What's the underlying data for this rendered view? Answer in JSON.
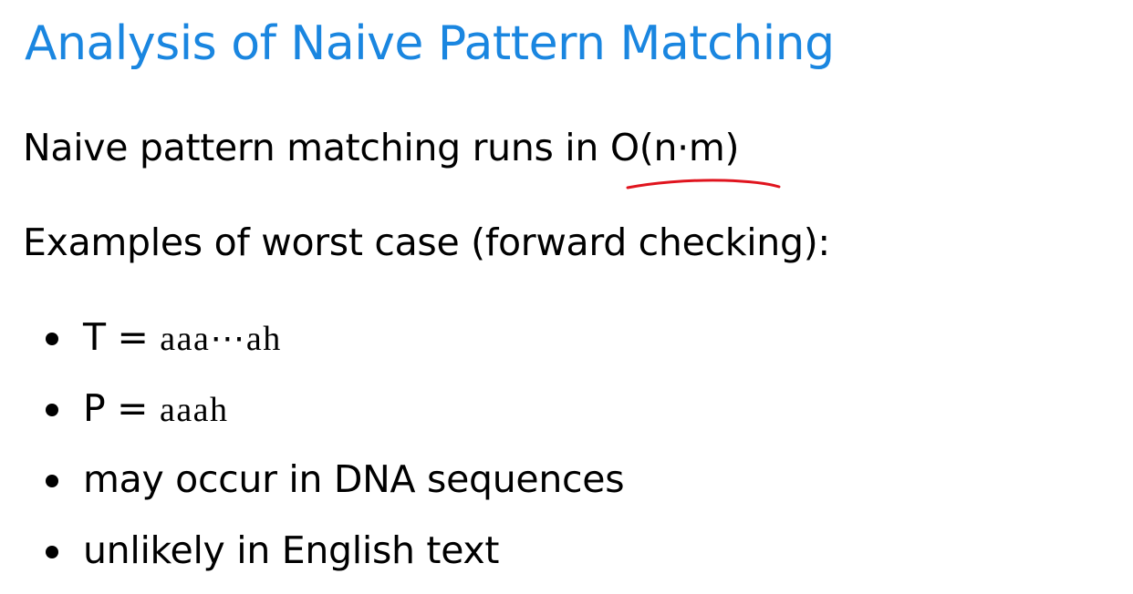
{
  "slide": {
    "title": "Analysis of Naive Pattern Matching",
    "line1_text": "Naive pattern matching runs in ",
    "line1_complexity": "O(n·m)",
    "line2_text": "Examples of worst case (forward checking):",
    "bullets": [
      {
        "prefix": "T = ",
        "value": "aaa⋯ah"
      },
      {
        "prefix": "P = ",
        "value": "aaah"
      },
      {
        "text": "may occur in DNA sequences"
      },
      {
        "text": "unlikely in English text"
      }
    ]
  },
  "colors": {
    "title": "#1a86e0",
    "text": "#000000",
    "annotation": "#e0141e",
    "background": "#ffffff"
  }
}
